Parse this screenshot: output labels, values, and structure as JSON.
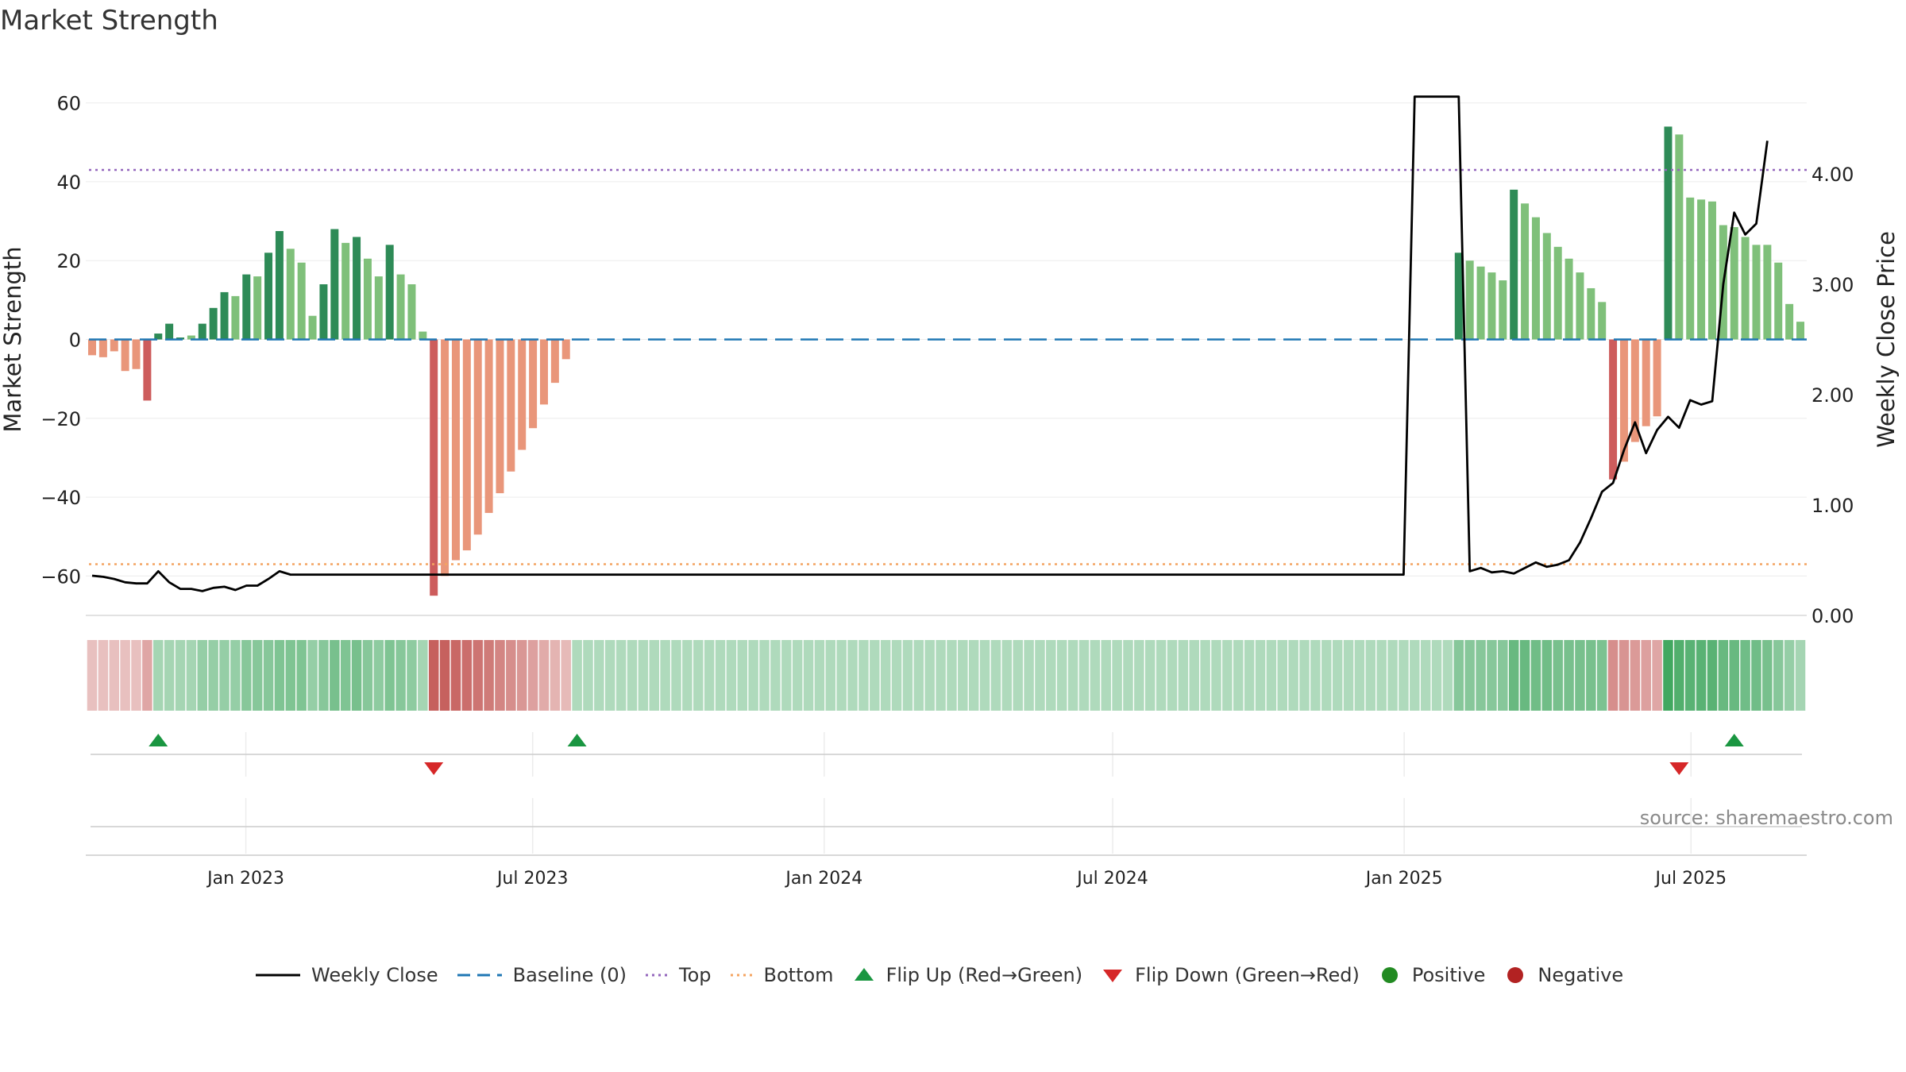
{
  "chart_data": {
    "type": "bar",
    "title": "Market Strength",
    "source": "source: sharemaestro.com",
    "ylabel_left": "Market Strength",
    "ylabel_right": "Weekly Close Price",
    "ylim_left": [
      -70,
      70
    ],
    "ylim_right": [
      0,
      5.0
    ],
    "yticks_left": [
      60,
      40,
      20,
      0,
      -20,
      -40,
      -60
    ],
    "yticks_left_labels": [
      "60",
      "40",
      "20",
      "0",
      "−20",
      "−40",
      "−60"
    ],
    "yticks_right": [
      4.0,
      3.0,
      2.0,
      1.0,
      0.0
    ],
    "yticks_right_labels": [
      "4.00",
      "3.00",
      "2.00",
      "1.00",
      "0.00"
    ],
    "x_start": "2022-09-26",
    "x_end": "2025-09-08",
    "x_ticks": [
      {
        "date": "2023-01-01",
        "label": "Jan 2023"
      },
      {
        "date": "2023-07-01",
        "label": "Jul 2023"
      },
      {
        "date": "2024-01-01",
        "label": "Jan 2024"
      },
      {
        "date": "2024-07-01",
        "label": "Jul 2024"
      },
      {
        "date": "2025-01-01",
        "label": "Jan 2025"
      },
      {
        "date": "2025-07-01",
        "label": "Jul 2025"
      }
    ],
    "top_line": 43,
    "bottom_line": -57,
    "baseline": 0,
    "strength": [
      -4,
      -4.5,
      -3,
      -8,
      -7.5,
      -15.5,
      1.5,
      4,
      0.5,
      1,
      4,
      8,
      12,
      11,
      16.5,
      16,
      22,
      27.5,
      23,
      19.5,
      6,
      14,
      28,
      24.5,
      26,
      20.5,
      16,
      24,
      16.5,
      14,
      2,
      -65,
      -60,
      -56,
      -53.5,
      -49.5,
      -44,
      -39,
      -33.5,
      -28,
      -22.5,
      -16.5,
      -11,
      -5,
      0,
      0,
      0,
      0,
      0,
      0,
      0,
      0,
      0,
      0,
      0,
      0,
      0,
      0,
      0,
      0,
      0,
      0,
      0,
      0,
      0,
      0,
      0,
      0,
      0,
      0,
      0,
      0,
      0,
      0,
      0,
      0,
      0,
      0,
      0,
      0,
      0,
      0,
      0,
      0,
      0,
      0,
      0,
      0,
      0,
      0,
      0,
      0,
      0,
      0,
      0,
      0,
      0,
      0,
      0,
      0,
      0,
      0,
      0,
      0,
      0,
      0,
      0,
      0,
      0,
      0,
      0,
      0,
      0,
      0,
      0,
      0,
      0,
      0,
      0,
      0,
      0,
      0,
      0,
      0,
      22,
      20,
      18.5,
      17,
      15,
      38,
      34.5,
      31,
      27,
      23.5,
      20.5,
      17,
      13,
      9.5,
      -35.5,
      -31,
      -26,
      -22,
      -19.5,
      54,
      52,
      36,
      35.5,
      35,
      29,
      28.5,
      26,
      24,
      24,
      19.5,
      9,
      4.5
    ],
    "bar_shade": [
      2,
      2,
      2,
      2,
      2,
      1,
      1,
      1,
      1,
      2,
      1,
      1,
      1,
      2,
      1,
      2,
      1,
      1,
      2,
      2,
      2,
      1,
      1,
      2,
      1,
      2,
      2,
      1,
      2,
      2,
      2,
      1,
      2,
      2,
      2,
      2,
      2,
      2,
      2,
      2,
      2,
      2,
      2,
      2,
      0,
      0,
      0,
      0,
      0,
      0,
      0,
      0,
      0,
      0,
      0,
      0,
      0,
      0,
      0,
      0,
      0,
      0,
      0,
      0,
      0,
      0,
      0,
      0,
      0,
      0,
      0,
      0,
      0,
      0,
      0,
      0,
      0,
      0,
      0,
      0,
      0,
      0,
      0,
      0,
      0,
      0,
      0,
      0,
      0,
      0,
      0,
      0,
      0,
      0,
      0,
      0,
      0,
      0,
      0,
      0,
      0,
      0,
      0,
      0,
      0,
      0,
      0,
      0,
      0,
      0,
      0,
      0,
      0,
      0,
      0,
      0,
      0,
      0,
      0,
      0,
      0,
      0,
      0,
      0,
      1,
      2,
      2,
      2,
      2,
      1,
      2,
      2,
      2,
      2,
      2,
      2,
      2,
      2,
      1,
      2,
      2,
      2,
      2,
      1,
      2,
      2,
      2,
      2,
      2,
      2,
      2,
      2,
      2,
      2,
      2,
      2
    ],
    "weekly_close": [
      0.36,
      0.35,
      0.33,
      0.3,
      0.29,
      0.29,
      0.4,
      0.3,
      0.24,
      0.24,
      0.22,
      0.25,
      0.26,
      0.23,
      0.27,
      0.27,
      0.33,
      0.4,
      0.37,
      0.37,
      0.37,
      0.37,
      0.37,
      0.37,
      0.37,
      0.37,
      0.37,
      0.37,
      0.37,
      0.37,
      0.37,
      0.37,
      0.37,
      0.37,
      0.37,
      0.37,
      0.37,
      0.37,
      0.37,
      0.37,
      0.37,
      0.37,
      0.37,
      0.37,
      0.37,
      0.37,
      0.37,
      0.37,
      0.37,
      0.37,
      0.37,
      0.37,
      0.37,
      0.37,
      0.37,
      0.37,
      0.37,
      0.37,
      0.37,
      0.37,
      0.37,
      0.37,
      0.37,
      0.37,
      0.37,
      0.37,
      0.37,
      0.37,
      0.37,
      0.37,
      0.37,
      0.37,
      0.37,
      0.37,
      0.37,
      0.37,
      0.37,
      0.37,
      0.37,
      0.37,
      0.37,
      0.37,
      0.37,
      0.37,
      0.37,
      0.37,
      0.37,
      0.37,
      0.37,
      0.37,
      0.37,
      0.37,
      0.37,
      0.37,
      0.37,
      0.37,
      0.37,
      0.37,
      0.37,
      0.37,
      0.37,
      0.37,
      0.37,
      0.37,
      0.37,
      0.37,
      0.37,
      0.37,
      0.37,
      0.37,
      0.37,
      0.37,
      0.37,
      0.37,
      0.37,
      0.37,
      0.37,
      0.37,
      0.37,
      0.37,
      4.7,
      4.7,
      4.7,
      4.7,
      4.7,
      0.4,
      0.43,
      0.39,
      0.4,
      0.38,
      0.43,
      0.48,
      0.44,
      0.46,
      0.5,
      0.66,
      0.88,
      1.12,
      1.2,
      1.5,
      1.75,
      1.47,
      1.68,
      1.8,
      1.7,
      1.95,
      1.91,
      1.94,
      3.0,
      3.65,
      3.45,
      3.55,
      4.3
    ],
    "strip_levels": [
      0.25,
      0.25,
      0.25,
      0.25,
      0.25,
      0.45,
      0.35,
      0.35,
      0.35,
      0.35,
      0.45,
      0.45,
      0.45,
      0.45,
      0.55,
      0.55,
      0.55,
      0.6,
      0.6,
      0.6,
      0.45,
      0.55,
      0.65,
      0.6,
      0.65,
      0.55,
      0.5,
      0.6,
      0.55,
      0.5,
      0.35,
      1.0,
      1.0,
      0.95,
      0.9,
      0.85,
      0.8,
      0.72,
      0.65,
      0.58,
      0.5,
      0.42,
      0.35,
      0.3,
      0.28,
      0.28,
      0.28,
      0.28,
      0.28,
      0.28,
      0.28,
      0.28,
      0.28,
      0.28,
      0.28,
      0.28,
      0.28,
      0.28,
      0.28,
      0.28,
      0.28,
      0.28,
      0.28,
      0.28,
      0.28,
      0.28,
      0.28,
      0.28,
      0.28,
      0.28,
      0.28,
      0.28,
      0.28,
      0.28,
      0.28,
      0.28,
      0.28,
      0.28,
      0.28,
      0.28,
      0.28,
      0.28,
      0.28,
      0.28,
      0.28,
      0.28,
      0.28,
      0.28,
      0.28,
      0.28,
      0.28,
      0.28,
      0.28,
      0.28,
      0.28,
      0.28,
      0.28,
      0.28,
      0.28,
      0.28,
      0.28,
      0.28,
      0.28,
      0.28,
      0.28,
      0.28,
      0.28,
      0.28,
      0.28,
      0.28,
      0.28,
      0.28,
      0.28,
      0.28,
      0.28,
      0.28,
      0.28,
      0.28,
      0.28,
      0.28,
      0.28,
      0.28,
      0.28,
      0.28,
      0.55,
      0.55,
      0.55,
      0.55,
      0.55,
      0.75,
      0.75,
      0.7,
      0.7,
      0.65,
      0.65,
      0.65,
      0.65,
      0.62,
      0.65,
      0.6,
      0.55,
      0.5,
      0.45,
      1.0,
      0.9,
      0.85,
      0.85,
      0.85,
      0.75,
      0.75,
      0.7,
      0.7,
      0.65,
      0.55,
      0.45,
      0.35
    ],
    "flip_up_weeks": [
      6,
      44,
      149
    ],
    "flip_down_weeks": [
      31,
      144
    ],
    "colors": {
      "green_dark": "#2e8b57",
      "green_light": "#7fc07a",
      "red_dark": "#cd5c5c",
      "red_light": "#e9967a",
      "top_line": "#9467bd",
      "bottom_line": "#f4a460",
      "baseline": "#1f77b4",
      "close_line": "#000000",
      "flip_up": "#1a9641",
      "flip_down": "#d62728",
      "positive": "#228b22",
      "negative": "#b22222",
      "strip_green": "#2e9e4f",
      "strip_red": "#c0504d"
    },
    "legend": [
      {
        "label": "Weekly Close",
        "kind": "solid-line"
      },
      {
        "label": "Baseline (0)",
        "kind": "dashed-line"
      },
      {
        "label": "Top",
        "kind": "dotted-purple"
      },
      {
        "label": "Bottom",
        "kind": "dotted-orange"
      },
      {
        "label": "Flip Up (Red→Green)",
        "kind": "triangle-up"
      },
      {
        "label": "Flip Down (Green→Red)",
        "kind": "triangle-down"
      },
      {
        "label": "Positive",
        "kind": "dot-green"
      },
      {
        "label": "Negative",
        "kind": "dot-red"
      }
    ]
  }
}
